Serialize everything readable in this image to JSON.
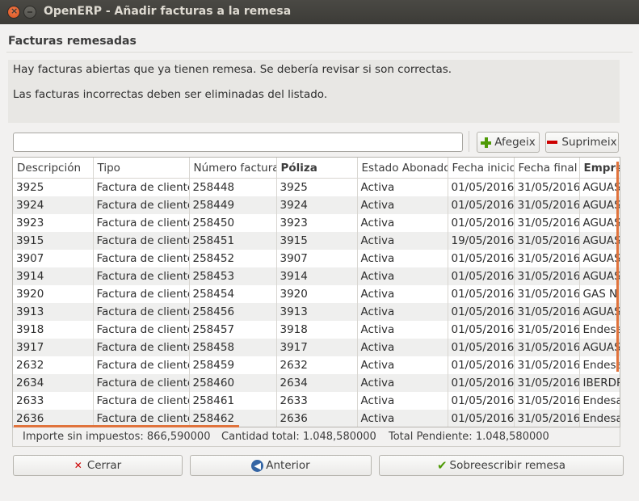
{
  "window": {
    "title": "OpenERP - Añadir facturas a la remesa"
  },
  "section": {
    "title": "Facturas remesadas"
  },
  "notice": {
    "line1": "Hay facturas abiertas que ya tienen remesa. Se debería revisar si son correctas.",
    "line2": "Las facturas incorrectas deben ser eliminadas del listado."
  },
  "search": {
    "value": ""
  },
  "toolbar": {
    "add_label": "Afegeix",
    "remove_label": "Suprimeix"
  },
  "table": {
    "columns": [
      "Descripción",
      "Tipo",
      "Número factura",
      "Póliza",
      "Estado Abonado",
      "Fecha inicio",
      "Fecha final",
      "Empre"
    ],
    "rows": [
      [
        "3925",
        "Factura de cliente",
        "258448",
        "3925",
        "Activa",
        "01/05/2016",
        "31/05/2016",
        "AGUAS"
      ],
      [
        "3924",
        "Factura de cliente",
        "258449",
        "3924",
        "Activa",
        "01/05/2016",
        "31/05/2016",
        "AGUAS"
      ],
      [
        "3923",
        "Factura de cliente",
        "258450",
        "3923",
        "Activa",
        "01/05/2016",
        "31/05/2016",
        "AGUAS"
      ],
      [
        "3915",
        "Factura de cliente",
        "258451",
        "3915",
        "Activa",
        "19/05/2016",
        "31/05/2016",
        "AGUAS"
      ],
      [
        "3907",
        "Factura de cliente",
        "258452",
        "3907",
        "Activa",
        "01/05/2016",
        "31/05/2016",
        "AGUAS"
      ],
      [
        "3914",
        "Factura de cliente",
        "258453",
        "3914",
        "Activa",
        "01/05/2016",
        "31/05/2016",
        "AGUAS"
      ],
      [
        "3920",
        "Factura de cliente",
        "258454",
        "3920",
        "Activa",
        "01/05/2016",
        "31/05/2016",
        "GAS N"
      ],
      [
        "3913",
        "Factura de cliente",
        "258456",
        "3913",
        "Activa",
        "01/05/2016",
        "31/05/2016",
        "AGUAS"
      ],
      [
        "3918",
        "Factura de cliente",
        "258457",
        "3918",
        "Activa",
        "01/05/2016",
        "31/05/2016",
        "Endesa"
      ],
      [
        "3917",
        "Factura de cliente",
        "258458",
        "3917",
        "Activa",
        "01/05/2016",
        "31/05/2016",
        "AGUAS"
      ],
      [
        "2632",
        "Factura de cliente",
        "258459",
        "2632",
        "Activa",
        "01/05/2016",
        "31/05/2016",
        "Endesa"
      ],
      [
        "2634",
        "Factura de cliente",
        "258460",
        "2634",
        "Activa",
        "01/05/2016",
        "31/05/2016",
        "IBERDR"
      ],
      [
        "2633",
        "Factura de cliente",
        "258461",
        "2633",
        "Activa",
        "01/05/2016",
        "31/05/2016",
        "Endesa"
      ],
      [
        "2636",
        "Factura de cliente",
        "258462",
        "2636",
        "Activa",
        "01/05/2016",
        "31/05/2016",
        "Endesa"
      ]
    ]
  },
  "totals": {
    "importe": "Importe sin impuestos: 866,590000",
    "cantidad": "Cantidad total: 1.048,580000",
    "pendiente": "Total Pendiente: 1.048,580000"
  },
  "buttons": {
    "cerrar": "Cerrar",
    "anterior": "Anterior",
    "sobreescribir": "Sobreescribir remesa"
  },
  "colors": {
    "accent": "#e0733c",
    "add": "#4e9a06",
    "remove": "#cc0000"
  }
}
